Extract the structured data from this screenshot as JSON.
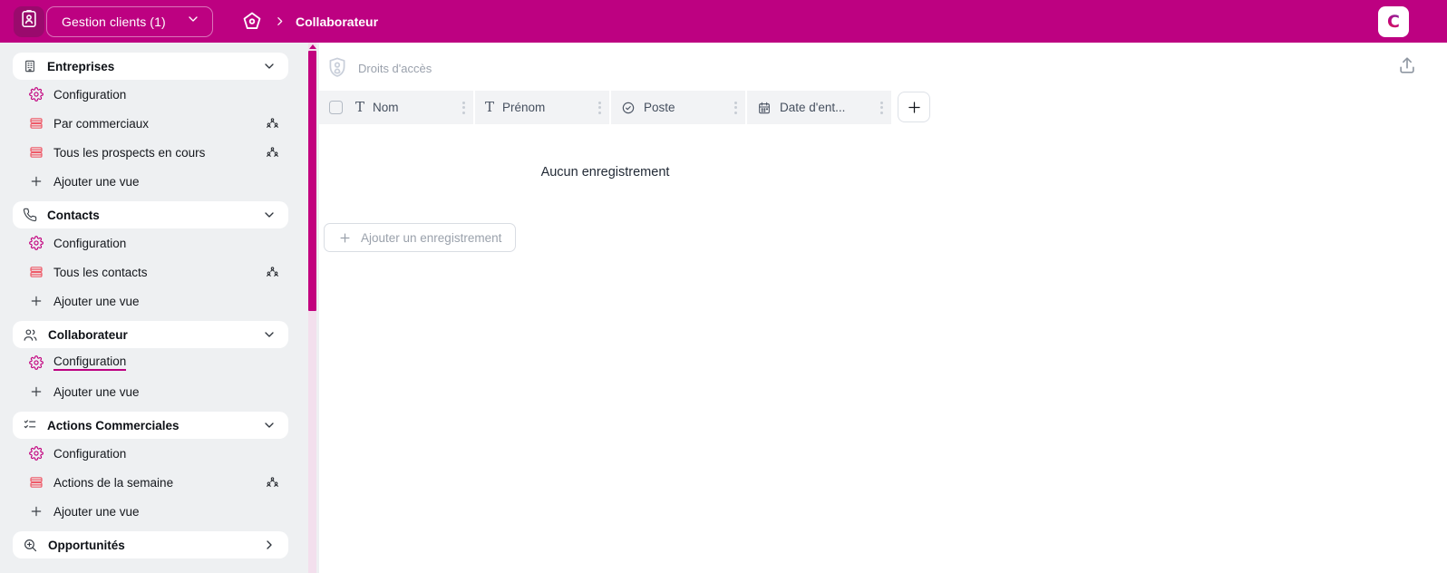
{
  "header": {
    "app_icon": "contact-book-icon",
    "workspace": {
      "label": "Gestion clients (1)",
      "chevron": "chevron-down-icon"
    },
    "breadcrumb": {
      "home_icon": "home-icon",
      "separator": "chevron-right-icon",
      "current": "Collaborateur"
    },
    "avatar": {
      "initial": "C"
    }
  },
  "sidebar": {
    "sections": [
      {
        "icon": "building-icon",
        "label": "Entreprises",
        "expanded": true,
        "items": [
          {
            "type": "config",
            "label": "Configuration"
          },
          {
            "type": "table",
            "label": "Par commerciaux",
            "shared": true
          },
          {
            "type": "table",
            "label": "Tous les prospects en cours",
            "shared": true
          },
          {
            "type": "add",
            "label": "Ajouter une vue"
          }
        ]
      },
      {
        "icon": "phone-icon",
        "label": "Contacts",
        "expanded": true,
        "items": [
          {
            "type": "config",
            "label": "Configuration"
          },
          {
            "type": "table",
            "label": "Tous les contacts",
            "shared": true
          },
          {
            "type": "add",
            "label": "Ajouter une vue"
          }
        ]
      },
      {
        "icon": "users-icon",
        "label": "Collaborateur",
        "expanded": true,
        "items": [
          {
            "type": "config",
            "label": "Configuration",
            "active": true
          },
          {
            "type": "add",
            "label": "Ajouter une vue"
          }
        ]
      },
      {
        "icon": "checklist-icon",
        "label": "Actions Commerciales",
        "expanded": true,
        "items": [
          {
            "type": "config",
            "label": "Configuration"
          },
          {
            "type": "table",
            "label": "Actions de la semaine",
            "shared": true
          },
          {
            "type": "add",
            "label": "Ajouter une vue"
          }
        ]
      },
      {
        "icon": "zoom-plus-icon",
        "label": "Opportunités",
        "expanded": false,
        "items": []
      }
    ]
  },
  "main": {
    "access_button": {
      "icon": "shield-user-icon",
      "label": "Droits d'accès"
    },
    "share_icon": "upload-icon",
    "table": {
      "columns": [
        {
          "icon": "text-field-icon",
          "label": "Nom"
        },
        {
          "icon": "text-field-icon",
          "label": "Prénom"
        },
        {
          "icon": "select-field-icon",
          "label": "Poste"
        },
        {
          "icon": "date-field-icon",
          "label": "Date d'ent..."
        }
      ],
      "add_column_icon": "plus-icon"
    },
    "empty_state": {
      "message": "Aucun enregistrement"
    },
    "add_record": {
      "icon": "plus-icon",
      "label": "Ajouter un enregistrement"
    }
  },
  "colors": {
    "header_bg": "#bd0181",
    "header_icon_bg": "#9a0a6d",
    "accent_magenta": "#c2017e",
    "table_icon_red": "#ee5a68",
    "sidebar_bg": "#eef0f2",
    "column_header_bg": "#f2f3f5",
    "muted_text": "#9aa1ac",
    "scroll_track": "#f3dfed"
  }
}
